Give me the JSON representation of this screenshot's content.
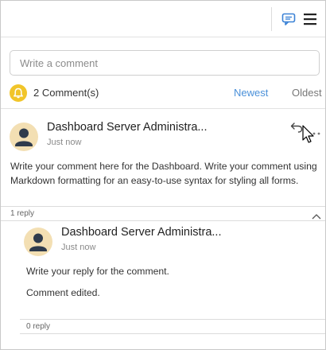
{
  "input": {
    "placeholder": "Write a comment"
  },
  "summary": {
    "count_label": "2 Comment(s)"
  },
  "sort": {
    "newest": "Newest",
    "oldest": "Oldest"
  },
  "comment": {
    "author": "Dashboard Server Administra...",
    "time": "Just now",
    "body": "Write your comment here for the Dashboard. Write your comment using Markdown formatting for an easy-to-use syntax for styling all forms.",
    "reply_count": "1 reply"
  },
  "reply": {
    "author": "Dashboard Server Administra...",
    "time": "Just now",
    "line1": "Write your reply for the comment.",
    "line2": "Comment edited.",
    "reply_count": "0 reply"
  },
  "colors": {
    "accent": "#4a90d9",
    "bell": "#f1c52a",
    "avatar_bg": "#f3dfb3",
    "avatar_fg": "#2f3b4c"
  },
  "icons": {
    "comment": "comment-icon",
    "menu": "hamburger-icon",
    "bell": "bell-icon",
    "reply": "reply-icon",
    "more": "more-icon",
    "collapse": "chevron-up-icon"
  }
}
